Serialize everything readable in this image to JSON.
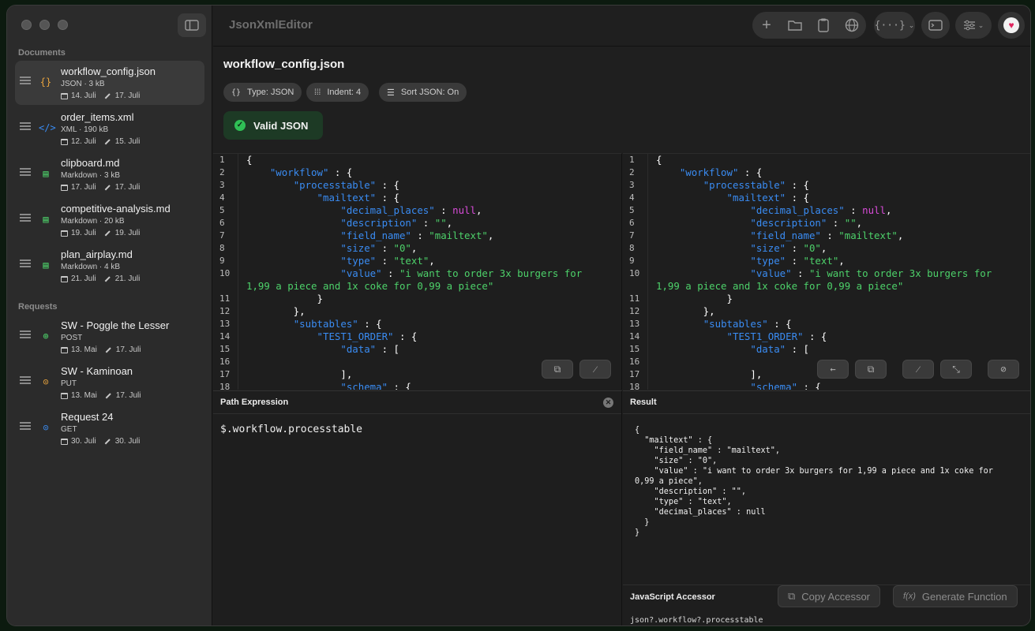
{
  "app": {
    "title": "JsonXmlEditor"
  },
  "sidebar": {
    "documents_label": "Documents",
    "requests_label": "Requests",
    "documents": [
      {
        "title": "workflow_config.json",
        "meta": "JSON · 3 kB",
        "created": "14. Juli",
        "modified": "17. Juli",
        "icon": "{}",
        "icon_color": "#e8a33d",
        "active": true
      },
      {
        "title": "order_items.xml",
        "meta": "XML · 190 kB",
        "created": "12. Juli",
        "modified": "15. Juli",
        "icon": "</>",
        "icon_color": "#3a8cf3",
        "active": false
      },
      {
        "title": "clipboard.md",
        "meta": "Markdown · 3 kB",
        "created": "17. Juli",
        "modified": "17. Juli",
        "icon": "▤",
        "icon_color": "#4dd16a",
        "active": false
      },
      {
        "title": "competitive-analysis.md",
        "meta": "Markdown · 20 kB",
        "created": "19. Juli",
        "modified": "19. Juli",
        "icon": "▤",
        "icon_color": "#4dd16a",
        "active": false
      },
      {
        "title": "plan_airplay.md",
        "meta": "Markdown · 4 kB",
        "created": "21. Juli",
        "modified": "21. Juli",
        "icon": "▤",
        "icon_color": "#4dd16a",
        "active": false
      }
    ],
    "requests": [
      {
        "title": "SW - Poggle the Lesser",
        "meta": "POST",
        "created": "13. Mai",
        "modified": "17. Juli",
        "icon": "⊕",
        "icon_color": "#4dd16a"
      },
      {
        "title": "SW - Kaminoan",
        "meta": "PUT",
        "created": "13. Mai",
        "modified": "17. Juli",
        "icon": "⊙",
        "icon_color": "#e8a33d"
      },
      {
        "title": "Request 24",
        "meta": "GET",
        "created": "30. Juli",
        "modified": "30. Juli",
        "icon": "⊙",
        "icon_color": "#3a8cf3"
      }
    ]
  },
  "header": {
    "doc_title": "workflow_config.json",
    "chips": {
      "type": "Type: JSON",
      "indent": "Indent: 4",
      "sort": "Sort JSON: On"
    },
    "valid_label": "Valid JSON"
  },
  "editor": {
    "line_numbers": [
      "1",
      "2",
      "3",
      "4",
      "5",
      "6",
      "7",
      "8",
      "9",
      "10",
      "11",
      "12",
      "13",
      "14",
      "15",
      "16",
      "17",
      "18"
    ]
  },
  "path_panel": {
    "title": "Path Expression",
    "expression": "$.workflow.processtable"
  },
  "result_panel": {
    "title": "Result",
    "text": "{\n  \"mailtext\" : {\n    \"field_name\" : \"mailtext\",\n    \"size\" : \"0\",\n    \"value\" : \"i want to order 3x burgers for 1,99 a piece and 1x coke for\n0,99 a piece\",\n    \"description\" : \"\",\n    \"type\" : \"text\",\n    \"decimal_places\" : null\n  }\n}",
    "js_title": "JavaScript Accessor",
    "copy_label": "Copy Accessor",
    "generate_label": "Generate Function",
    "accessor": "json?.workflow?.processtable"
  }
}
